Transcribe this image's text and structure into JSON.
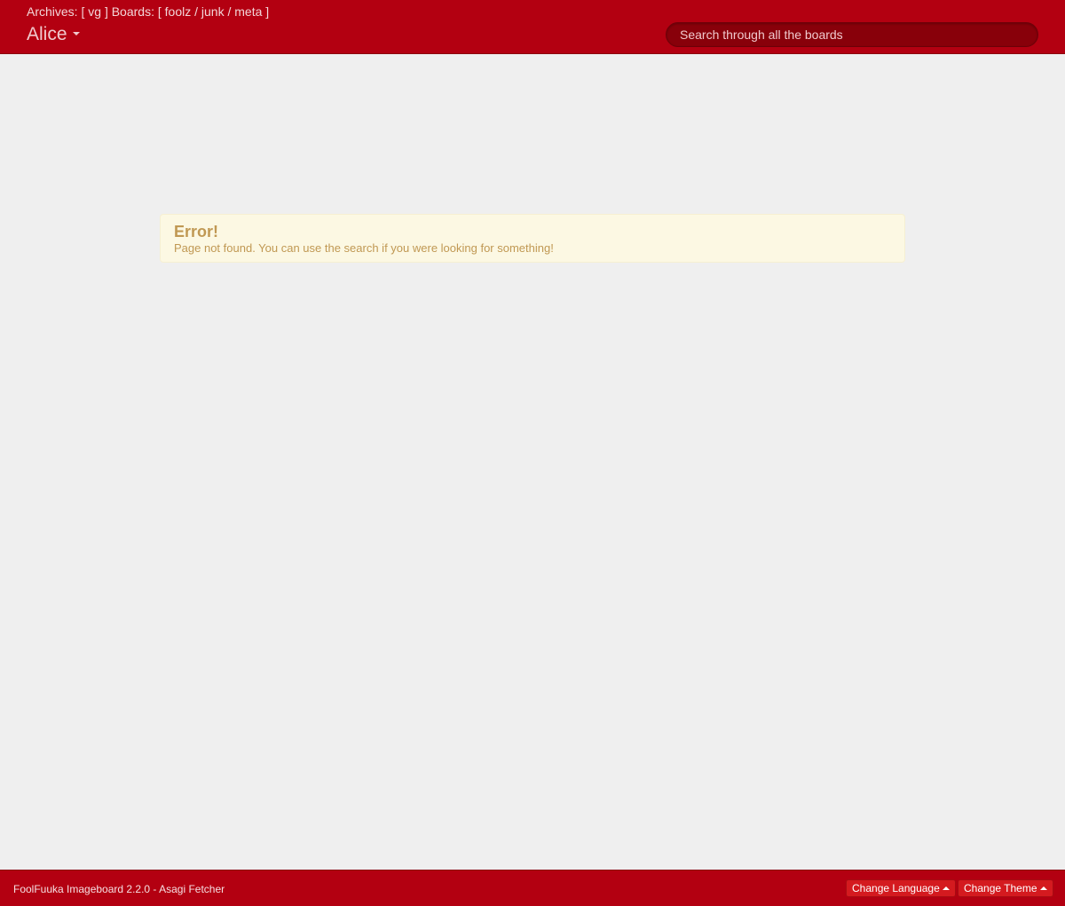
{
  "header": {
    "archives_label": "Archives: [",
    "archives": [
      "vg"
    ],
    "boards_label": "] Boards: [",
    "boards": [
      "foolz",
      "junk",
      "meta"
    ],
    "boards_separator": " / ",
    "closing_bracket": "]",
    "brand": "Alice",
    "search_placeholder": "Search through all the boards"
  },
  "alert": {
    "title": "Error!",
    "message": "Page not found. You can use the search if you were looking for something!"
  },
  "footer": {
    "text": "FoolFuuka Imageboard 2.2.0 - Asagi Fetcher",
    "language_button": "Change Language",
    "theme_button": "Change Theme"
  },
  "colors": {
    "header_bg": "#b30011",
    "page_bg": "#efefef",
    "alert_bg": "#fcf8e3",
    "alert_text": "#c09853",
    "footer_button": "#d41a1f"
  }
}
